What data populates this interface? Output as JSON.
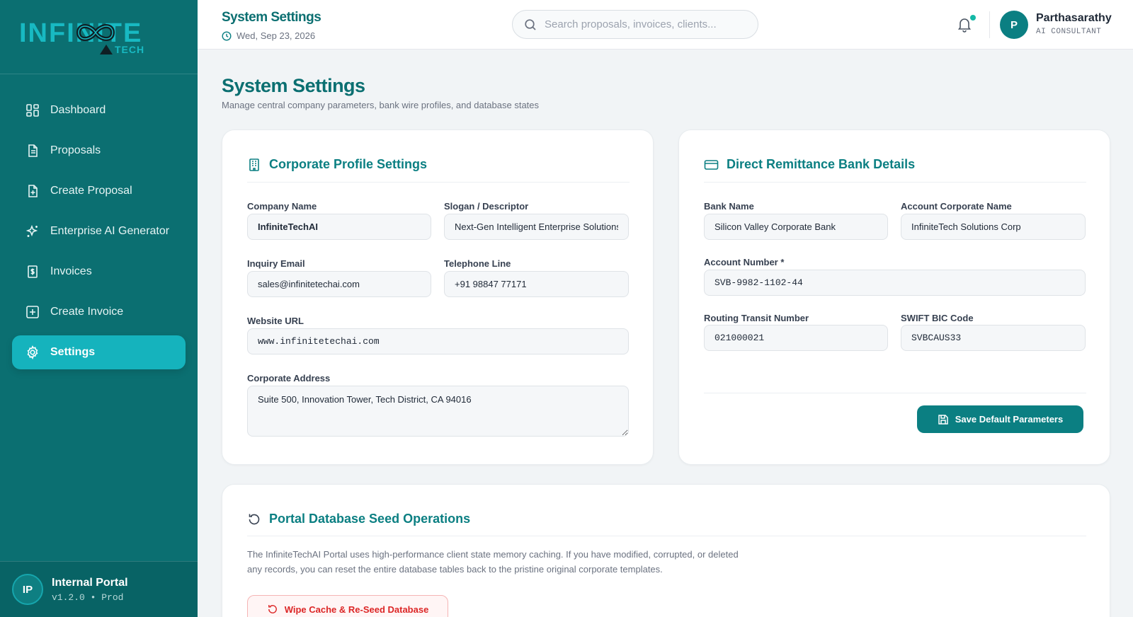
{
  "brand": {
    "logo_main": "INFINITE",
    "logo_sub": "TECH"
  },
  "sidebar": {
    "items": [
      {
        "label": "Dashboard",
        "icon": "grid-icon"
      },
      {
        "label": "Proposals",
        "icon": "document-icon"
      },
      {
        "label": "Create Proposal",
        "icon": "document-plus-icon"
      },
      {
        "label": "Enterprise AI Generator",
        "icon": "sparkles-icon"
      },
      {
        "label": "Invoices",
        "icon": "invoice-dollar-icon"
      },
      {
        "label": "Create Invoice",
        "icon": "plus-square-icon"
      },
      {
        "label": "Settings",
        "icon": "gear-icon",
        "active": true
      }
    ],
    "footer": {
      "initials": "IP",
      "title": "Internal Portal",
      "version": "v1.2.0 • Prod"
    }
  },
  "topbar": {
    "title": "System Settings",
    "date": "Wed, Sep 23, 2026",
    "search_placeholder": "Search proposals, invoices, clients...",
    "user": {
      "initial": "P",
      "name": "Parthasarathy",
      "role": "AI CONSULTANT"
    }
  },
  "page": {
    "title": "System Settings",
    "subtitle": "Manage central company parameters, bank wire profiles, and database states"
  },
  "corporate": {
    "heading": "Corporate Profile Settings",
    "company_name_label": "Company Name",
    "company_name": "InfiniteTechAI",
    "slogan_label": "Slogan / Descriptor",
    "slogan": "Next-Gen Intelligent Enterprise Solutions",
    "email_label": "Inquiry Email",
    "email": "sales@infinitetechai.com",
    "phone_label": "Telephone Line",
    "phone": "+91 98847 77171",
    "website_label": "Website URL",
    "website": "www.infinitetechai.com",
    "address_label": "Corporate Address",
    "address": "Suite 500, Innovation Tower, Tech District, CA 94016"
  },
  "bank": {
    "heading": "Direct Remittance Bank Details",
    "bank_name_label": "Bank Name",
    "bank_name": "Silicon Valley Corporate Bank",
    "account_corp_label": "Account Corporate Name",
    "account_corp": "InfiniteTech Solutions Corp",
    "account_number_label": "Account Number *",
    "account_number": "SVB-9982-1102-44",
    "routing_label": "Routing Transit Number",
    "routing": "021000021",
    "swift_label": "SWIFT BIC Code",
    "swift": "SVBCAUS33",
    "save_label": "Save Default Parameters"
  },
  "seed": {
    "heading": "Portal Database Seed Operations",
    "description": "The InfiniteTechAI Portal uses high-performance client state memory caching. If you have modified, corrupted, or deleted any records, you can reset the entire database tables back to the pristine original corporate templates.",
    "wipe_label": "Wipe Cache & Re-Seed Database"
  },
  "colors": {
    "primary": "#0b6f71",
    "accent": "#15b3bd",
    "danger": "#dc2626"
  }
}
